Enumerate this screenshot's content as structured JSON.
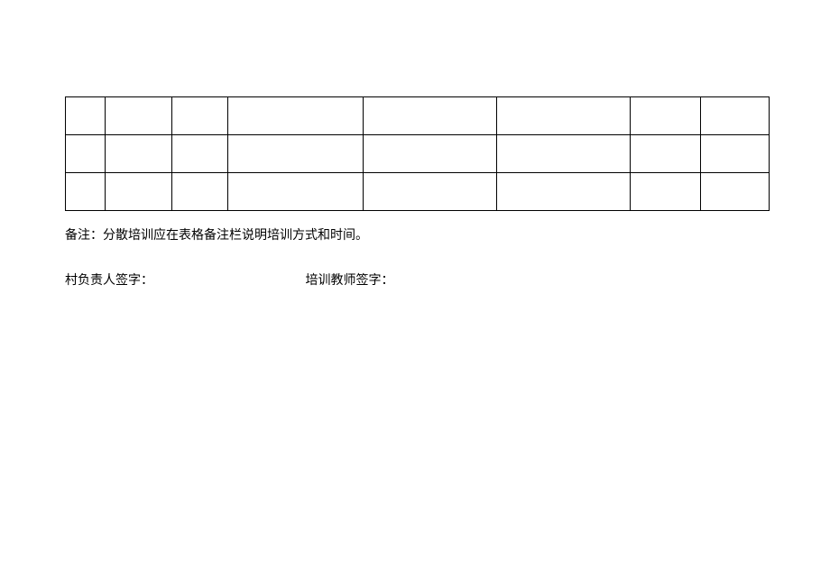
{
  "table": {
    "rows": 3,
    "columns": 8
  },
  "note": "备注：分散培训应在表格备注栏说明培训方式和时间。",
  "signature": {
    "village_leader": "村负责人签字：",
    "teacher": "培训教师签字："
  }
}
